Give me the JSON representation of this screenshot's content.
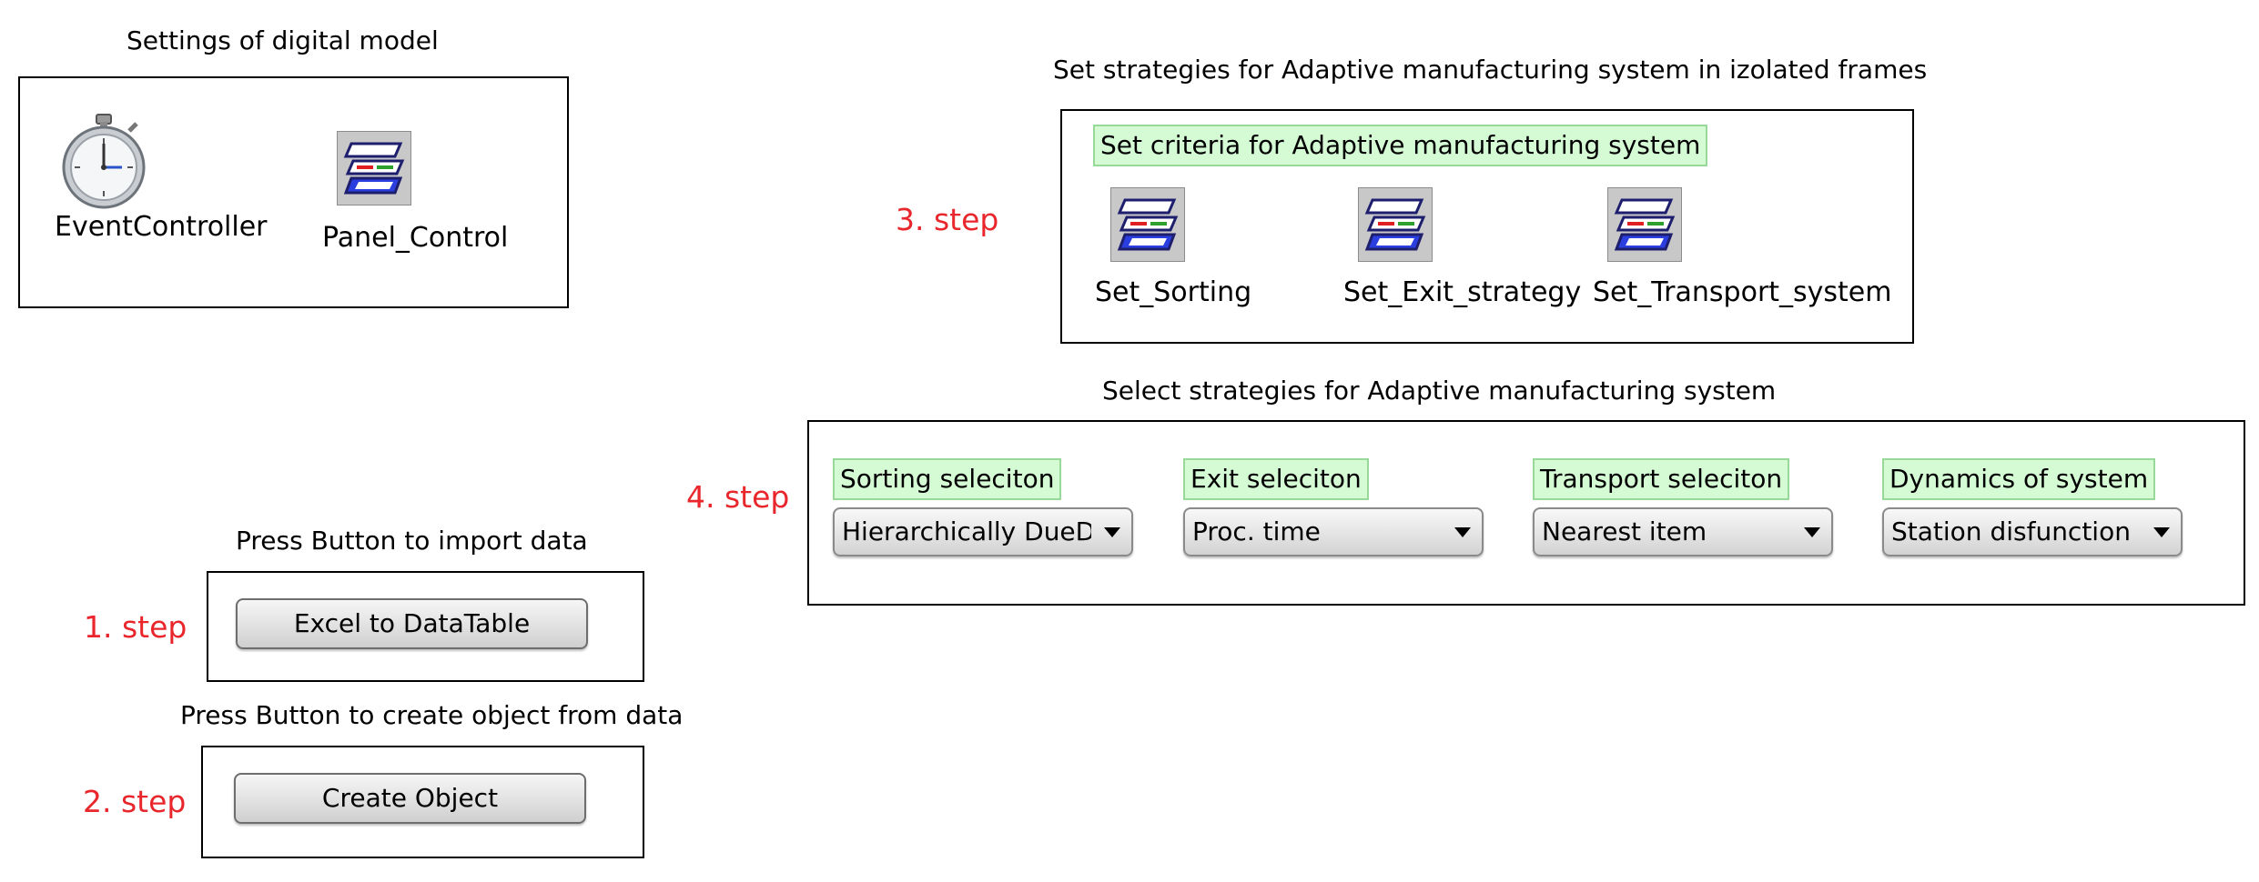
{
  "settings": {
    "title": "Settings of digital model",
    "event_controller_label": "EventController",
    "panel_control_label": "Panel_Control"
  },
  "strategies_frame": {
    "title": "Set strategies for Adaptive manufacturing system in izolated frames",
    "criteria_label": "Set criteria for Adaptive manufacturing system",
    "items": [
      {
        "label": "Set_Sorting",
        "icon": "frame-icon"
      },
      {
        "label": "Set_Exit_strategy",
        "icon": "frame-icon"
      },
      {
        "label": "Set_Transport_system",
        "icon": "frame-icon"
      }
    ]
  },
  "select_frame": {
    "title": "Select strategies for Adaptive manufacturing system",
    "dropdowns": [
      {
        "label": "Sorting seleciton",
        "value": "Hierarchically DueDa"
      },
      {
        "label": "Exit seleciton",
        "value": "Proc. time"
      },
      {
        "label": "Transport seleciton",
        "value": "Nearest item"
      },
      {
        "label": "Dynamics of system",
        "value": "Station disfunction"
      }
    ]
  },
  "import": {
    "title": "Press Button to import data",
    "button": "Excel to DataTable"
  },
  "create": {
    "title": "Press Button to create object from data",
    "button": "Create Object"
  },
  "steps": {
    "step1": "1. step",
    "step2": "2. step",
    "step3": "3. step",
    "step4": "4. step"
  },
  "colors": {
    "step_text": "#e8262b",
    "label_bg": "#d5fbd5",
    "label_border": "#98d898"
  }
}
